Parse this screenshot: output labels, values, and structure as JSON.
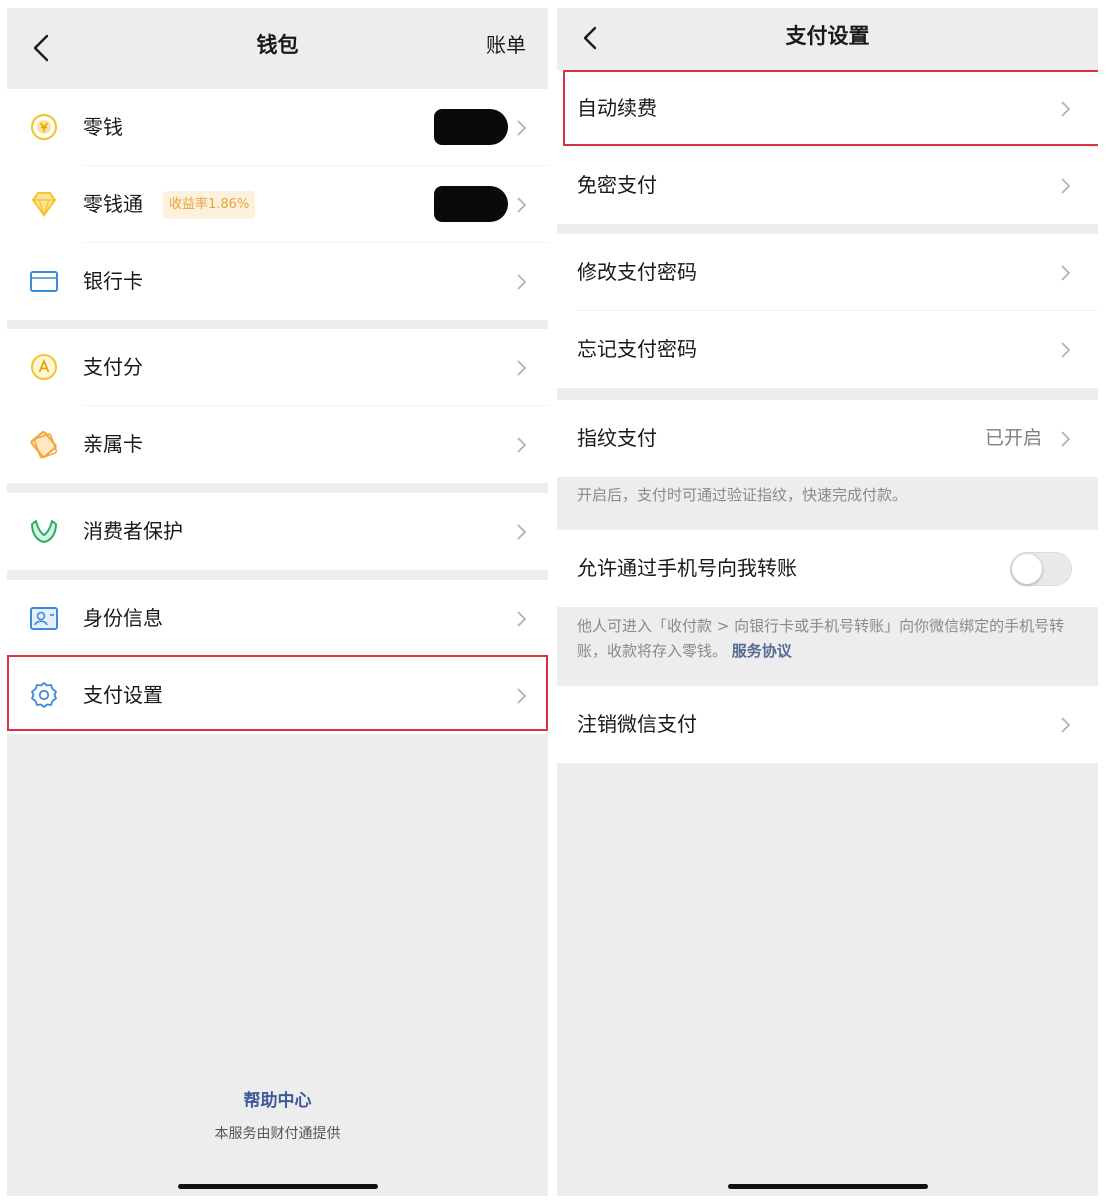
{
  "wallet": {
    "nav": {
      "title": "钱包",
      "right_link": "账单"
    },
    "items": [
      {
        "label": "零钱",
        "icon": "coin-icon"
      },
      {
        "label": "零钱通",
        "icon": "diamond-icon",
        "badge": "收益率1.86%"
      },
      {
        "label": "银行卡",
        "icon": "bank-card-icon"
      },
      {
        "label": "支付分",
        "icon": "pay-score-icon"
      },
      {
        "label": "亲属卡",
        "icon": "family-card-icon"
      },
      {
        "label": "消费者保护",
        "icon": "protection-icon"
      },
      {
        "label": "身份信息",
        "icon": "id-card-icon"
      },
      {
        "label": "支付设置",
        "icon": "gear-icon"
      }
    ],
    "footer": {
      "help_link": "帮助中心",
      "note": "本服务由财付通提供"
    }
  },
  "payment_settings": {
    "nav": {
      "title": "支付设置"
    },
    "items": {
      "auto_renew": "自动续费",
      "password_free": "免密支付",
      "change_password": "修改支付密码",
      "forgot_password": "忘记支付密码",
      "fingerprint": "指纹支付",
      "fingerprint_status": "已开启",
      "allow_phone_transfer": "允许通过手机号向我转账",
      "cancel_wechat_pay": "注销微信支付"
    },
    "allow_phone_transfer_enabled": false,
    "fingerprint_hint": "开启后，支付时可通过验证指纹，快速完成付款。",
    "phone_transfer_hint": "他人可进入「收付款 > 向银行卡或手机号转账」向你微信绑定的手机号转账，收款将存入零钱。",
    "phone_transfer_hint_link": "服务协议"
  },
  "colors": {
    "highlight": "#d9333f",
    "link": "#576b95",
    "badge_text": "#e5a53a",
    "icon_yellow": "#f4c431",
    "icon_blue": "#3d8ad9",
    "icon_green": "#2aae67"
  }
}
